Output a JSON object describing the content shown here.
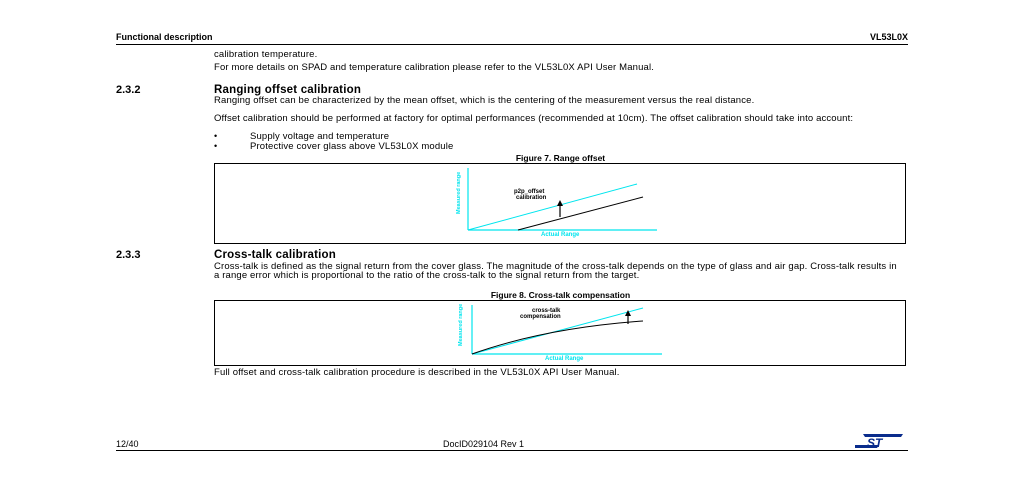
{
  "header": {
    "section": "Functional description",
    "product": "VL53L0X"
  },
  "intro": {
    "line1": "calibration temperature.",
    "para1": "For more details on SPAD and temperature calibration please refer to the VL53L0X API User Manual."
  },
  "section_232": {
    "number": "2.3.2",
    "title": "Ranging offset calibration",
    "para1": "Ranging offset can be characterized by the mean offset, which is the centering of the measurement versus the real distance.",
    "para2": "Offset calibration should be performed at factory for optimal performances (recommended at 10cm). The offset calibration should take into account:",
    "bullets": [
      "Supply voltage and temperature",
      "Protective cover glass above VL53L0X module"
    ],
    "figure": {
      "caption": "Figure 7. Range offset",
      "ylabel": "Measured range",
      "xlabel": "Actual Range",
      "annotation_line1": "p2p_offset",
      "annotation_line2": "calibration"
    }
  },
  "section_233": {
    "number": "2.3.3",
    "title": "Cross-talk calibration",
    "para1": "Cross-talk is defined as the signal return from the cover glass. The magnitude of the cross-talk depends on the type of glass and air gap. Cross-talk results in a range error which is proportional to the ratio of the cross-talk to the signal return from the target.",
    "figure": {
      "caption": "Figure 8. Cross-talk compensation",
      "ylabel": "Measured range",
      "xlabel": "Actual Range",
      "annotation_line1": "cross-talk",
      "annotation_line2": "compensation"
    },
    "para2": "Full offset and cross-talk calibration procedure is described in the VL53L0X API User Manual."
  },
  "footer": {
    "page": "12/40",
    "doc_id": "DocID029104 Rev 1",
    "logo_text": "ST"
  },
  "colors": {
    "accent_cyan": "#00e5ee",
    "logo_blue": "#0a2c8c"
  }
}
